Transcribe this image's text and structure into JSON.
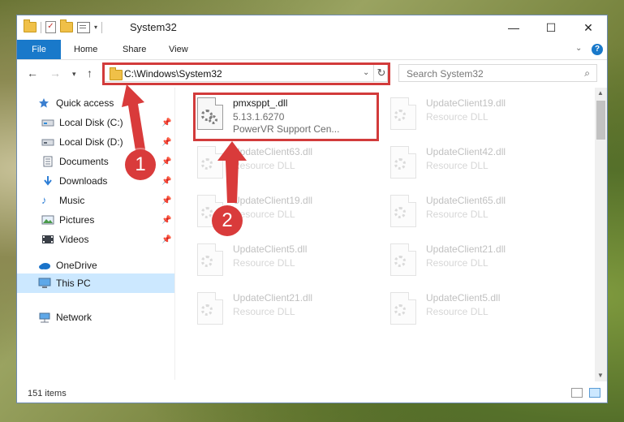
{
  "window": {
    "title": "System32",
    "controls": {
      "minimize": "—",
      "maximize": "☐",
      "close": "✕"
    }
  },
  "ribbon": {
    "tabs": [
      {
        "label": "File"
      },
      {
        "label": "Home"
      },
      {
        "label": "Share"
      },
      {
        "label": "View"
      }
    ],
    "help": "?"
  },
  "address": {
    "path": "C:\\Windows\\System32",
    "search_placeholder": "Search System32"
  },
  "sidebar": {
    "items": [
      {
        "label": "Quick access",
        "icon": "star-icon"
      },
      {
        "label": "Local Disk (C:)",
        "icon": "drive-icon",
        "pinned": true
      },
      {
        "label": "Local Disk (D:)",
        "icon": "drive-icon",
        "pinned": true
      },
      {
        "label": "Documents",
        "icon": "documents-icon",
        "pinned": true
      },
      {
        "label": "Downloads",
        "icon": "download-icon",
        "pinned": true
      },
      {
        "label": "Music",
        "icon": "music-icon",
        "pinned": true
      },
      {
        "label": "Pictures",
        "icon": "pictures-icon",
        "pinned": true
      },
      {
        "label": "Videos",
        "icon": "videos-icon",
        "pinned": true
      },
      {
        "label": "OneDrive",
        "icon": "cloud-icon"
      },
      {
        "label": "This PC",
        "icon": "computer-icon",
        "selected": true
      },
      {
        "label": "Network",
        "icon": "network-icon"
      }
    ]
  },
  "files": {
    "highlighted": {
      "name": "pmxsppt_.dll",
      "version": "5.13.1.6270",
      "description": "PowerVR Support Cen..."
    },
    "others": [
      {
        "name": "UpdateClient19.dll",
        "type": "Resource DLL"
      },
      {
        "name": "UpdateClient63.dll",
        "type": "Resource DLL"
      },
      {
        "name": "UpdateClient42.dll",
        "type": "Resource DLL"
      },
      {
        "name": "UpdateClient19.dll",
        "type": "Resource DLL"
      },
      {
        "name": "UpdateClient65.dll",
        "type": "Resource DLL"
      },
      {
        "name": "UpdateClient5.dll",
        "type": "Resource DLL"
      },
      {
        "name": "UpdateClient21.dll",
        "type": "Resource DLL"
      },
      {
        "name": "UpdateClient21.dll",
        "type": "Resource DLL"
      },
      {
        "name": "UpdateClient5.dll",
        "type": "Resource DLL"
      }
    ]
  },
  "status": {
    "item_count": "151 items"
  },
  "annotations": {
    "step1": "1",
    "step2": "2",
    "highlight_color": "#d23b3b"
  }
}
